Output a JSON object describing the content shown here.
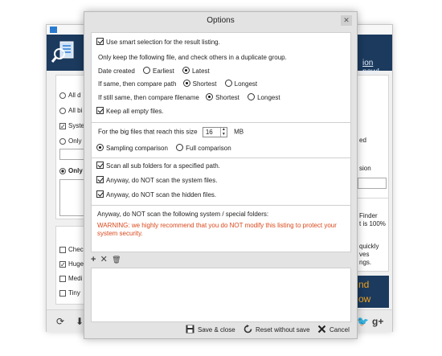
{
  "dialog": {
    "title": "Options",
    "close_label": "✕",
    "options": {
      "smart_selection": {
        "label": "Use smart selection for the result listing.",
        "checked": true
      },
      "keep_following": "Only keep the following file, and check others in a duplicate group.",
      "date_created": {
        "label": "Date created",
        "earliest": "Earliest",
        "latest": "Latest",
        "selected": "Latest"
      },
      "compare_path": {
        "label": "If same, then compare path",
        "shortest": "Shortest",
        "longest": "Longest",
        "selected": "Shortest"
      },
      "compare_filename": {
        "label": "If still same, then compare filename",
        "shortest": "Shortest",
        "longest": "Longest",
        "selected": "Shortest"
      },
      "keep_empty": {
        "label": "Keep all empty files.",
        "checked": true
      },
      "big_files": {
        "label": "For the big files that reach this size",
        "value": "16",
        "unit": "MB"
      },
      "comparison": {
        "sampling": "Sampling comparison",
        "full": "Full comparison",
        "selected": "Sampling comparison"
      },
      "scan_subfolders": {
        "label": "Scan all sub folders for a specified path.",
        "checked": true
      },
      "skip_system": {
        "label": "Anyway, do NOT scan the system files.",
        "checked": true
      },
      "skip_hidden": {
        "label": "Anyway, do NOT scan the hidden files.",
        "checked": true
      },
      "special_folders": "Anyway, do NOT scan the following system / special folders:",
      "warning": "WARNING: we highly recommend that you do NOT modify this listing to protect your system security."
    },
    "list_tools": {
      "add": "+",
      "remove": "✕",
      "delete": "🗑"
    },
    "footer": {
      "save": "Save & close",
      "reset": "Reset without save",
      "cancel": "Cancel"
    }
  },
  "background_app": {
    "link_text": "ion now!",
    "left_items": [
      "All d",
      "All bi",
      "Syste",
      "Only",
      "Only"
    ],
    "left_items2": [
      "Chec",
      "Huge",
      "Medi",
      "Tiny"
    ],
    "right_text1": "ed",
    "right_text2": "sion",
    "right_text3": [
      "Finder",
      "t is 100%",
      "quickly",
      "ves",
      "ngs."
    ],
    "promo_text": [
      "nd",
      "ow"
    ],
    "social": [
      "🐦",
      "g+"
    ]
  },
  "colors": {
    "header_bg": "#1b3a5e",
    "warning": "#d9481b",
    "promo_text": "#f2a21b",
    "dialog_bg": "#e3e3e3"
  }
}
